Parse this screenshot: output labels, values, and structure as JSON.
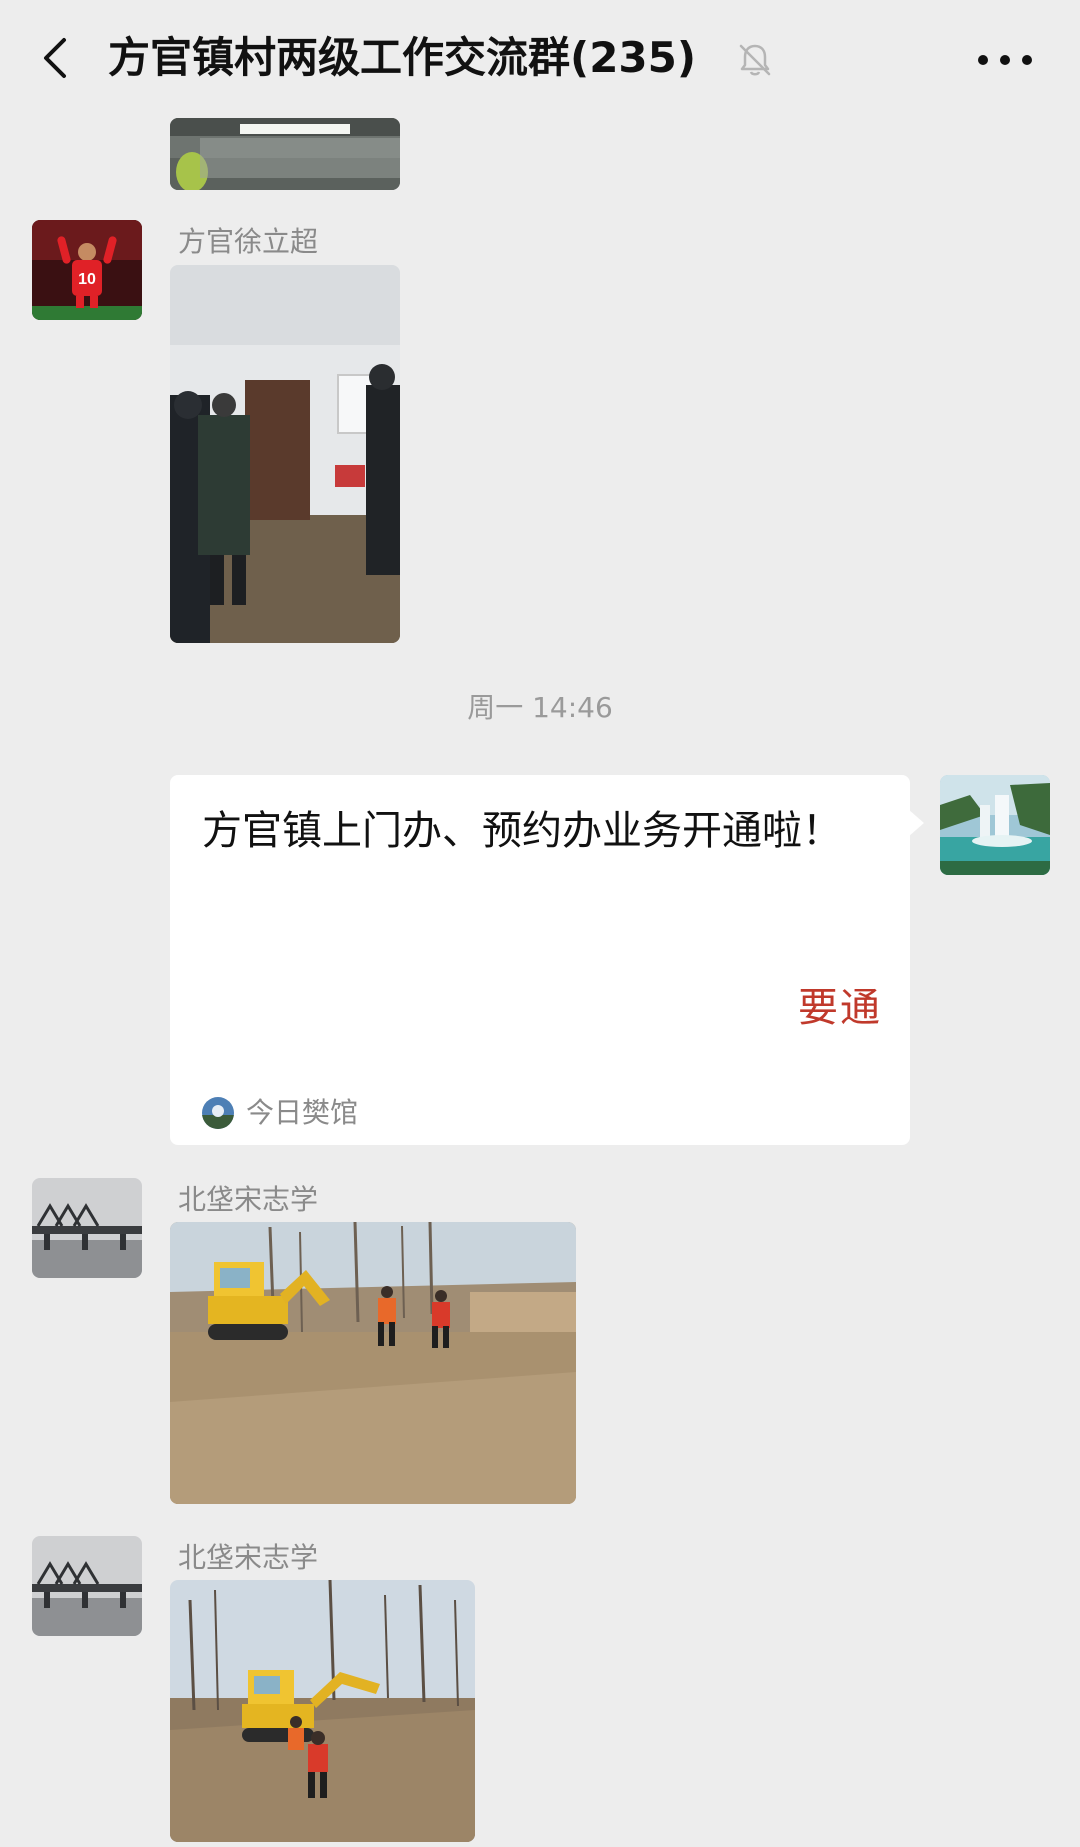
{
  "header": {
    "title": "方官镇村两级工作交流群(235)",
    "back_icon": "chevron-left-icon",
    "mute_icon": "bell-muted-icon",
    "more_icon": "more-horizontal-icon"
  },
  "messages": [
    {
      "type": "image",
      "sender": "",
      "image": "partial-photo-top"
    },
    {
      "type": "image",
      "sender": "方官徐立超",
      "avatar": "footballer-number-10-avatar",
      "image": "indoor-room-people-photo"
    },
    {
      "type": "timestamp",
      "text": "周一 14:46"
    },
    {
      "type": "link-card",
      "own": true,
      "avatar": "waterfall-avatar",
      "title": "方官镇上门办、预约办业务开通啦！",
      "thumb_text": "要通",
      "source": "今日樊馆"
    },
    {
      "type": "image",
      "sender": "北垡宋志学",
      "avatar": "bridge-avatar",
      "image": "excavator-field-workers-photo"
    },
    {
      "type": "image",
      "sender": "北垡宋志学",
      "avatar": "bridge-avatar",
      "image": "excavator-trees-workers-photo"
    }
  ],
  "colors": {
    "background": "#ededed",
    "bubble": "#ffffff",
    "meta_text": "#8a8a8a",
    "accent_red": "#c0392b"
  }
}
